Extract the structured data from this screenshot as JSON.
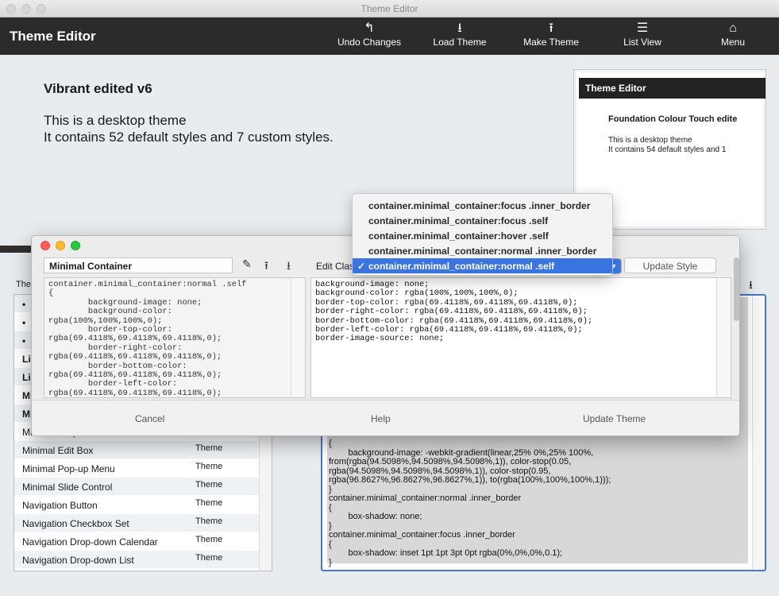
{
  "window": {
    "title": "Theme Editor"
  },
  "toolbar": {
    "title": "Theme Editor",
    "buttons": [
      {
        "label": "Undo Changes",
        "icon": "undo-icon"
      },
      {
        "label": "Load Theme",
        "icon": "upload-tray-icon"
      },
      {
        "label": "Make Theme",
        "icon": "upload-tray-icon"
      },
      {
        "label": "List View",
        "icon": "list-icon"
      },
      {
        "label": "Menu",
        "icon": "home-icon"
      }
    ]
  },
  "theme": {
    "name": "Vibrant edited v6",
    "line1": "This is a desktop theme",
    "line2": "It contains 52 default styles and 7 custom styles."
  },
  "preview_card": {
    "bar_title": "Theme Editor",
    "name": "Foundation Colour Touch edite",
    "line1": "This is a desktop theme",
    "line2": "It contains 54 default styles and 1"
  },
  "styles_label": "The",
  "styles_list": [
    {
      "name": "•",
      "type": ""
    },
    {
      "name": "•",
      "type": ""
    },
    {
      "name": "•",
      "type": ""
    },
    {
      "name": "Li",
      "type": ""
    },
    {
      "name": "Li",
      "type": ""
    },
    {
      "name": "Mi",
      "type": ""
    },
    {
      "name": "Mi",
      "type": ""
    },
    {
      "name": "Minimal Drop-down List",
      "type": "Theme"
    },
    {
      "name": "Minimal Edit Box",
      "type": "Theme"
    },
    {
      "name": "Minimal Pop-up Menu",
      "type": "Theme"
    },
    {
      "name": "Minimal Slide Control",
      "type": "Theme"
    },
    {
      "name": "Navigation Button",
      "type": "Theme"
    },
    {
      "name": "Navigation Checkbox Set",
      "type": "Theme"
    },
    {
      "name": "Navigation Drop-down Calendar",
      "type": "Theme"
    },
    {
      "name": "Navigation Drop-down List",
      "type": "Theme"
    }
  ],
  "bg_code": "{\n        background-image: -webkit-gradient(linear,25% 0%,25% 100%,\nfrom(rgba(94.5098%,94.5098%,94.5098%,1)), color-stop(0.05,\nrgba(94.5098%,94.5098%,94.5098%,1)), color-stop(0.95,\nrgba(96.8627%,96.8627%,96.8627%,1)), to(rgba(100%,100%,100%,1)));\n}\ncontainer.minimal_container:normal .inner_border\n{\n        box-shadow: none;\n}\ncontainer.minimal_container:focus .inner_border\n{\n        box-shadow: inset 1pt 1pt 3pt 0pt rgba(0%,0%,0%,0.1);\n}",
  "dialog": {
    "style_name": "Minimal Container",
    "edit_class_label": "Edit Clas",
    "selected_class": "container.minimal_container:normal .self",
    "update_style": "Update Style",
    "left_code": "container.minimal_container:normal .self\n{\n        background-image: none;\n        background-color:\nrgba(100%,100%,100%,0);\n        border-top-color:\nrgba(69.4118%,69.4118%,69.4118%,0);\n        border-right-color:\nrgba(69.4118%,69.4118%,69.4118%,0);\n        border-bottom-color:\nrgba(69.4118%,69.4118%,69.4118%,0);\n        border-left-color:\nrgba(69.4118%,69.4118%,69.4118%,0);",
    "right_code": "background-image: none;\nbackground-color: rgba(100%,100%,100%,0);\nborder-top-color: rgba(69.4118%,69.4118%,69.4118%,0);\nborder-right-color: rgba(69.4118%,69.4118%,69.4118%,0);\nborder-bottom-color: rgba(69.4118%,69.4118%,69.4118%,0);\nborder-left-color: rgba(69.4118%,69.4118%,69.4118%,0);\nborder-image-source: none;",
    "footer": {
      "cancel": "Cancel",
      "help": "Help",
      "update_theme": "Update Theme"
    }
  },
  "class_dropdown": {
    "options": [
      "container.minimal_container:focus .inner_border",
      "container.minimal_container:focus .self",
      "container.minimal_container:hover .self",
      "container.minimal_container:normal .inner_border",
      "container.minimal_container:normal .self"
    ],
    "selected_index": 4
  },
  "colors": {
    "toolbar_bg": "#2b2b2b",
    "accent": "#3a74e0"
  }
}
